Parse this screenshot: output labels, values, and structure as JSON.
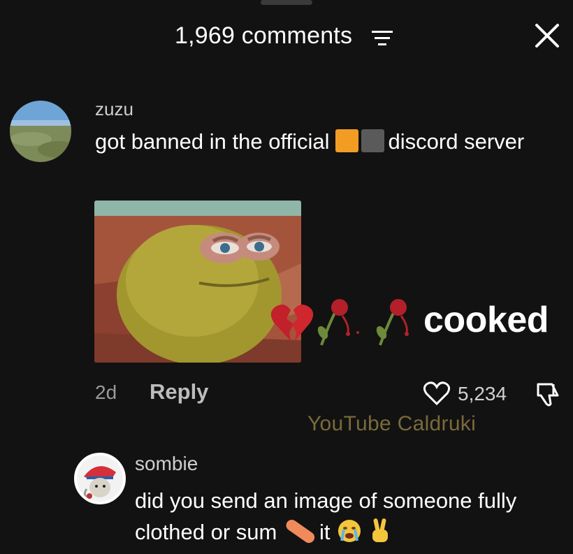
{
  "header": {
    "title": "1,969 comments",
    "sort_icon": "sort-lines-icon",
    "close_icon": "close-x-icon"
  },
  "comment1": {
    "username": "zuzu",
    "text_before": "got banned in the official",
    "text_after": "discord server",
    "inline_emojis": [
      "orange-square",
      "black-square"
    ],
    "image": "sad-pepe-potato-meme",
    "reaction_emojis": [
      "broken-heart",
      "wilted-rose",
      "wilted-rose"
    ],
    "reaction_text": "cooked",
    "age": "2d",
    "reply_label": "Reply",
    "likes": "5,234"
  },
  "watermark": "YouTube Caldruki",
  "comment2": {
    "username": "sombie",
    "text_line1": "did you send an image of someone fully",
    "text_line2a": "clothed or sum",
    "text_line2b": "it",
    "trailing_emojis": [
      "crying-face",
      "victory-hand"
    ]
  },
  "colors": {
    "background": "#121212",
    "accent_orange": "#f39c24",
    "watermark": "#7a6a3a"
  }
}
